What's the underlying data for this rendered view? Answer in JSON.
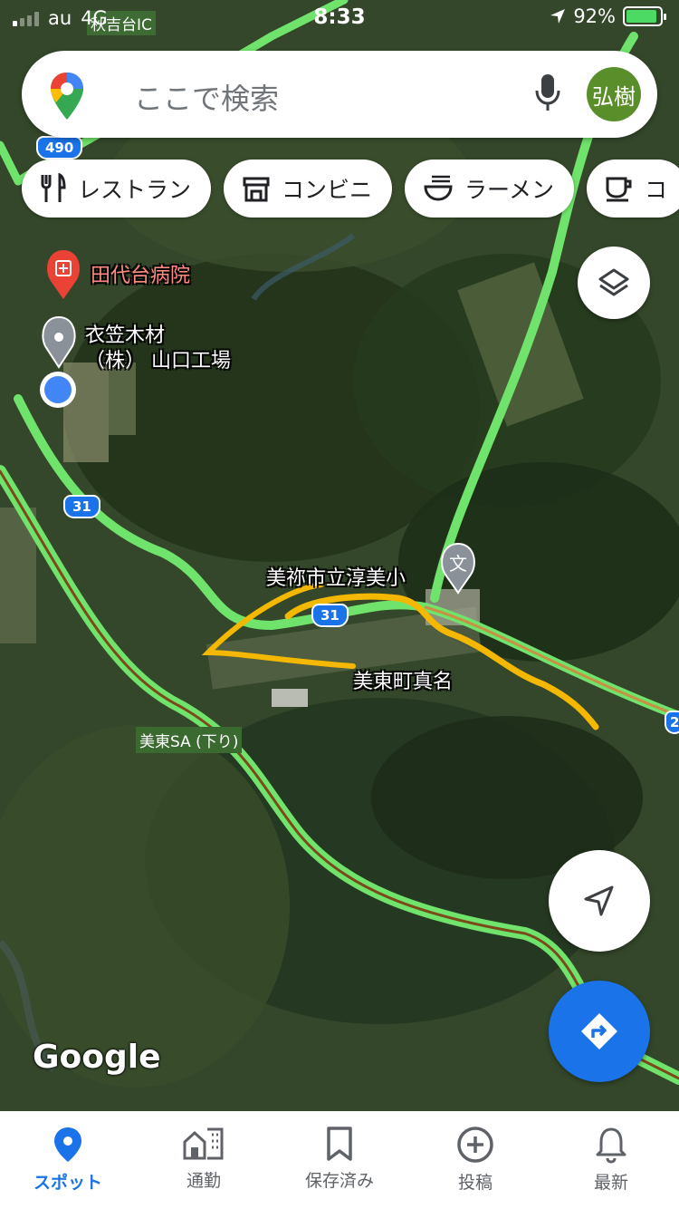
{
  "status_bar": {
    "carrier": "au",
    "network": "4G",
    "time": "8:33",
    "battery": "92%",
    "battery_level": 0.92,
    "ic_label": "秋吉台IC"
  },
  "search": {
    "placeholder": "ここで検索",
    "avatar_text": "弘樹"
  },
  "chips": [
    {
      "label": "レストラン",
      "icon": "fork-knife-icon"
    },
    {
      "label": "コンビニ",
      "icon": "store-icon"
    },
    {
      "label": "ラーメン",
      "icon": "ramen-icon"
    },
    {
      "label": "コ",
      "icon": "coffee-icon"
    }
  ],
  "map": {
    "hospital": "田代台病院",
    "factory_line1": "衣笠木材",
    "factory_line2": "（株） 山口工場",
    "school": "美祢市立淳美小",
    "school_icon": "文",
    "town": "美東町真名",
    "service_area": "美東SA (下り)",
    "route_490": "490",
    "route_31a": "31",
    "route_31b": "31",
    "route_edge": "2",
    "google": "Google"
  },
  "colors": {
    "accent": "#1a73e8",
    "traffic_green": "#6fe36b",
    "annotation_yellow": "#f5b800",
    "avatar_bg": "#5a8e2a"
  },
  "nav": [
    {
      "label": "スポット",
      "icon": "explore-pin-icon",
      "active": true
    },
    {
      "label": "通勤",
      "icon": "commute-icon",
      "active": false
    },
    {
      "label": "保存済み",
      "icon": "bookmark-icon",
      "active": false
    },
    {
      "label": "投稿",
      "icon": "add-circle-icon",
      "active": false
    },
    {
      "label": "最新",
      "icon": "bell-icon",
      "active": false
    }
  ]
}
